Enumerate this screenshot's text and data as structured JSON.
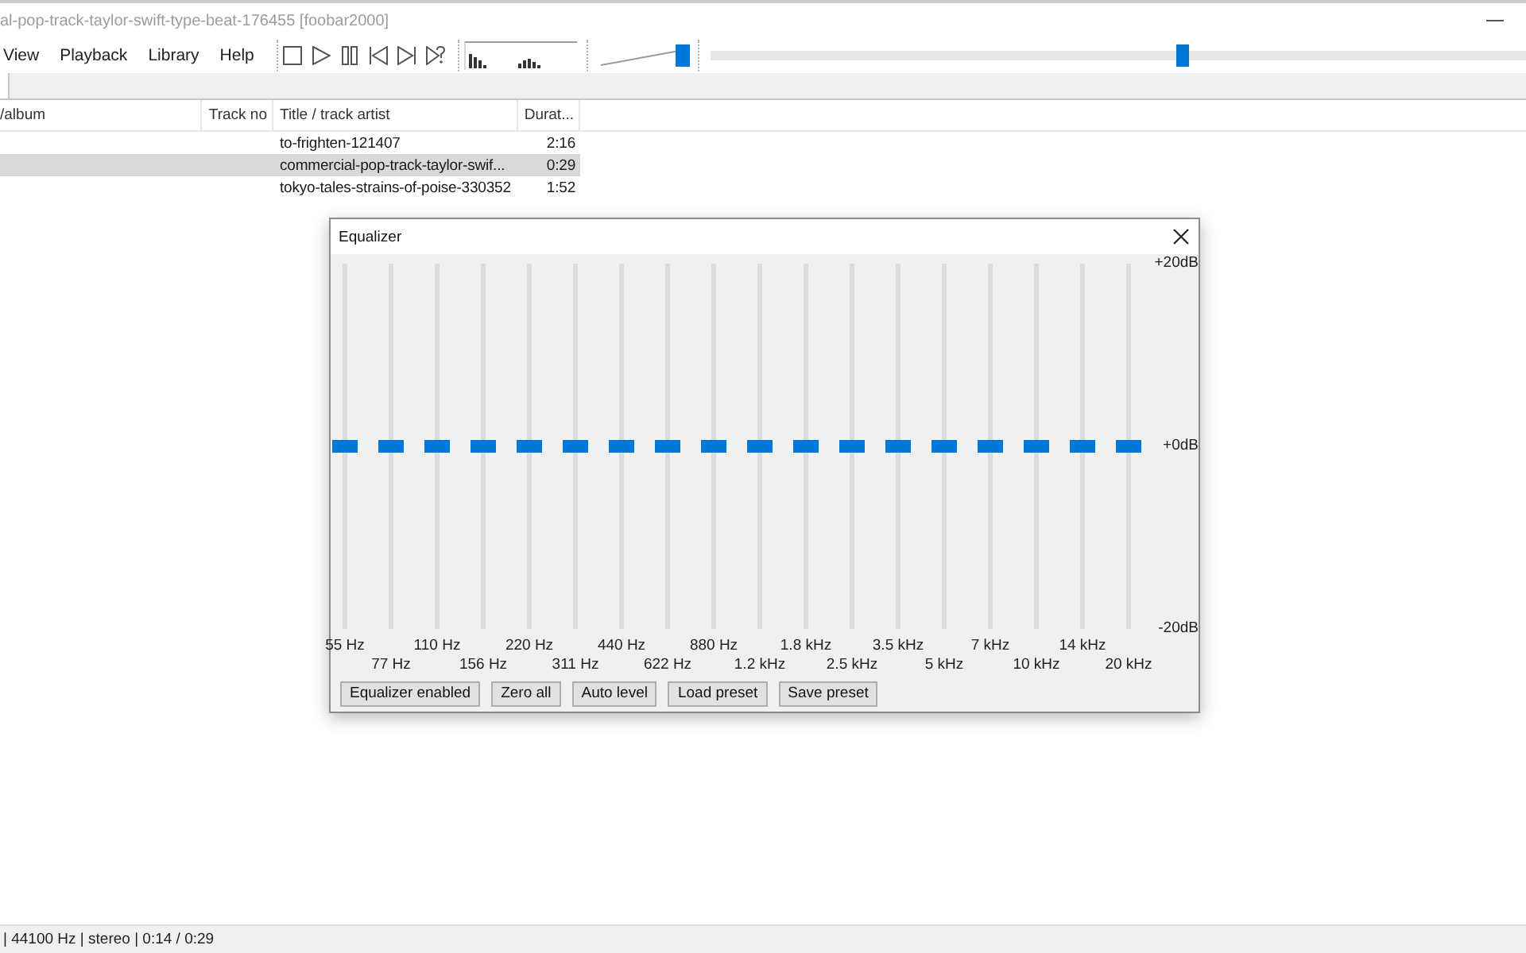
{
  "window": {
    "title": "al-pop-track-taylor-swift-type-beat-176455 [foobar2000]"
  },
  "menu": [
    "View",
    "Playback",
    "Library",
    "Help"
  ],
  "volume": {
    "level": 1
  },
  "seekbar": {
    "level": 0.58
  },
  "playlist": {
    "columns": [
      "/album",
      "Track no",
      "Title / track artist",
      "Durat..."
    ],
    "rows": [
      {
        "title": "to-frighten-121407",
        "duration": "2:16",
        "selected": false
      },
      {
        "title": "commercial-pop-track-taylor-swif...",
        "duration": "0:29",
        "selected": true
      },
      {
        "title": "tokyo-tales-strains-of-poise-330352",
        "duration": "1:52",
        "selected": false
      }
    ]
  },
  "equalizer": {
    "title": "Equalizer",
    "scale": [
      "+20dB",
      "+0dB",
      "-20dB"
    ],
    "bands": [
      {
        "label": "55 Hz",
        "level": 0.5
      },
      {
        "label": "77 Hz",
        "level": 0.5
      },
      {
        "label": "110 Hz",
        "level": 0.5
      },
      {
        "label": "156 Hz",
        "level": 0.5
      },
      {
        "label": "220 Hz",
        "level": 0.5
      },
      {
        "label": "311 Hz",
        "level": 0.5
      },
      {
        "label": "440 Hz",
        "level": 0.5
      },
      {
        "label": "622 Hz",
        "level": 0.5
      },
      {
        "label": "880 Hz",
        "level": 0.5
      },
      {
        "label": "1.2 kHz",
        "level": 0.5
      },
      {
        "label": "1.8 kHz",
        "level": 0.5
      },
      {
        "label": "2.5 kHz",
        "level": 0.5
      },
      {
        "label": "3.5 kHz",
        "level": 0.5
      },
      {
        "label": "5 kHz",
        "level": 0.5
      },
      {
        "label": "7 kHz",
        "level": 0.5
      },
      {
        "label": "10 kHz",
        "level": 0.5
      },
      {
        "label": "14 kHz",
        "level": 0.5
      },
      {
        "label": "20 kHz",
        "level": 0.5
      }
    ],
    "buttons": [
      "Equalizer enabled",
      "Zero all",
      "Auto level",
      "Load preset",
      "Save preset"
    ]
  },
  "status_bar": {
    "text": "| 44100 Hz | stereo | 0:14 / 0:29"
  }
}
